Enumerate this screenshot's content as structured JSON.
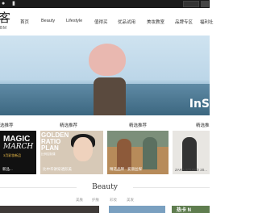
{
  "topbar": {
    "wechat_icon": "wechat-icon",
    "phone_icon": "mobile-icon"
  },
  "logo": {
    "main": "客",
    "sub": "BM"
  },
  "nav": {
    "items": [
      {
        "label": "首页"
      },
      {
        "label": "Beauty"
      },
      {
        "label": "Lifestyle"
      },
      {
        "label": "值得买"
      },
      {
        "label": "优品试用"
      },
      {
        "label": "美妆教室"
      },
      {
        "label": "品牌专区"
      },
      {
        "label": "福利社"
      }
    ]
  },
  "hero": {
    "brand": "InS"
  },
  "sections": [
    {
      "label": "选推荐"
    },
    {
      "label": "精选推荐"
    },
    {
      "label": "精选推荐"
    },
    {
      "label": "精选推"
    }
  ],
  "cards": [
    {
      "title_line1": "MAGIC",
      "title_line2": "MARCH",
      "tag": "3月彩妆新品",
      "caption": "新品..."
    },
    {
      "title": "GOLDEN RATIO PLAN",
      "tag": "比例控制课",
      "caption": "比中华讲穿透形美"
    },
    {
      "caption": "精选品牌 · 爱丽丝探"
    },
    {
      "caption": "ZARA STUDIO 20..."
    }
  ],
  "beauty": {
    "title": "Beauty",
    "subnav": [
      {
        "label": "美肤"
      },
      {
        "label": "护肤"
      },
      {
        "label": "彩妆"
      },
      {
        "label": "美发"
      }
    ]
  },
  "bottom": {
    "overlay_text": "热卡 N"
  }
}
